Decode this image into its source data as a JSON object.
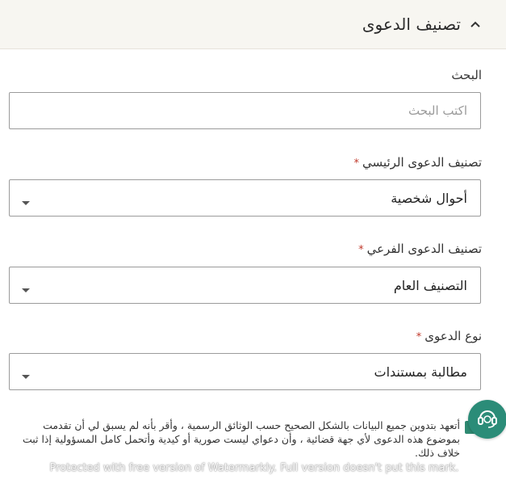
{
  "section": {
    "title": "تصنيف الدعوى",
    "toggle_icon": "chevron-up-icon"
  },
  "search": {
    "label": "البحث",
    "placeholder": "اكتب البحث",
    "value": ""
  },
  "main_category": {
    "label": "تصنيف الدعوى الرئيسي",
    "required_mark": "*",
    "selected": "أحوال شخصية"
  },
  "sub_category": {
    "label": "تصنيف الدعوى الفرعي",
    "required_mark": "*",
    "selected": "التصنيف العام"
  },
  "claim_type": {
    "label": "نوع الدعوى",
    "required_mark": "*",
    "selected": "مطالبة بمستندات"
  },
  "pledge": {
    "checked": true,
    "text": "أتعهد بتدوين جميع البيانات بالشكل الصحيح حسب الوثائق الرسمية ، وأقر بأنه لم يسبق لي أن تقدمت بموضوع هذه الدعوى لأي جهة قضائية ، وأن دعواي ليست صورية أو كيدية وأتحمل كامل المسؤولية إذا ثبت خلاف ذلك."
  },
  "support_button": {
    "icon": "headset-icon"
  },
  "watermark": "Protected with free version of Watermarkly. Full version doesn't put this mark.",
  "colors": {
    "accent": "#2b8c78",
    "header_bg": "#f7f6f1",
    "required": "#c0392b"
  }
}
